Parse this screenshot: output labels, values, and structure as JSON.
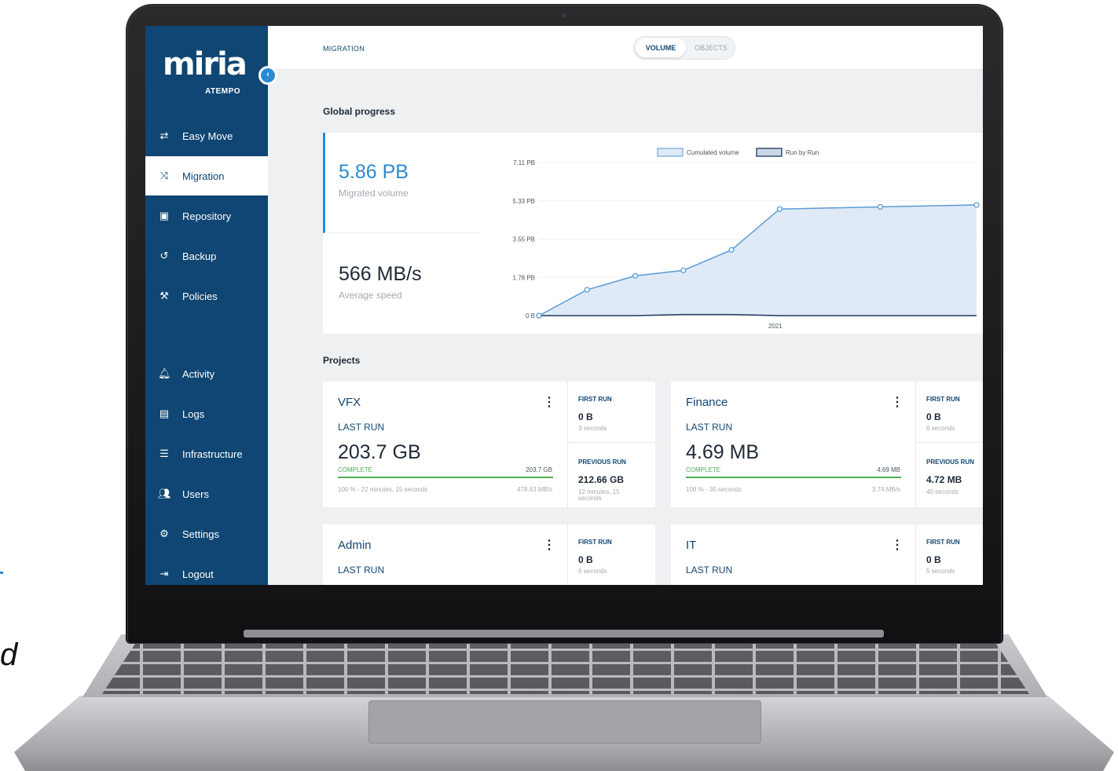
{
  "sidebar": {
    "logo": "miria",
    "logo_sub": "ATEMPO",
    "items": [
      {
        "label": "Easy Move",
        "icon": "swap-arrows-icon"
      },
      {
        "label": "Migration",
        "icon": "migration-arrows-icon"
      },
      {
        "label": "Repository",
        "icon": "repository-icon"
      },
      {
        "label": "Backup",
        "icon": "backup-history-icon"
      },
      {
        "label": "Policies",
        "icon": "gavel-icon"
      },
      {
        "label": "Activity",
        "icon": "bell-icon"
      },
      {
        "label": "Logs",
        "icon": "clipboard-icon"
      },
      {
        "label": "Infrastructure",
        "icon": "server-list-icon"
      },
      {
        "label": "Users",
        "icon": "users-icon"
      },
      {
        "label": "Settings",
        "icon": "gear-icon"
      },
      {
        "label": "Logout",
        "icon": "logout-icon"
      }
    ],
    "active": "Migration"
  },
  "header": {
    "breadcrumb": "MIGRATION",
    "toggle_on": "VOLUME",
    "toggle_off": "OBJECTS"
  },
  "global": {
    "title": "Global progress",
    "volume_value": "5.86 PB",
    "volume_label": "Migrated volume",
    "speed_value": "566 MB/s",
    "speed_label": "Average speed"
  },
  "projects_title": "Projects",
  "projects": [
    {
      "name": "VFX",
      "last_run": "LAST RUN",
      "volume": "203.7 GB",
      "status": "COMPLETE",
      "end_volume": "203.7 GB",
      "progress": 1.0,
      "info": "100 % - 22 minutes, 15 seconds",
      "speed": "478.43 MB/s",
      "first_run_title": "FIRST RUN",
      "first_run_value": "0 B",
      "first_run_time": "3 seconds",
      "prev_run_title": "PREVIOUS RUN",
      "prev_run_value": "212.66 GB",
      "prev_run_time": "12 minutes, 15 seconds"
    },
    {
      "name": "Finance",
      "last_run": "LAST RUN",
      "volume": "4.69 MB",
      "status": "COMPLETE",
      "end_volume": "4.69 MB",
      "progress": 1.0,
      "info": "100 % - 35 seconds",
      "speed": "3.74 MB/s",
      "first_run_title": "FIRST RUN",
      "first_run_value": "0 B",
      "first_run_time": "6 seconds",
      "prev_run_title": "PREVIOUS RUN",
      "prev_run_value": "4.72 MB",
      "prev_run_time": "40 seconds"
    },
    {
      "name": "Admin",
      "last_run": "LAST RUN",
      "first_run_title": "FIRST RUN",
      "first_run_value": "0 B",
      "first_run_time": "6 seconds"
    },
    {
      "name": "IT",
      "last_run": "LAST RUN",
      "first_run_title": "FIRST RUN",
      "first_run_value": "0 B",
      "first_run_time": "5 seconds"
    }
  ],
  "chart_data": {
    "type": "area",
    "series": [
      {
        "name": "Cumulated volume",
        "values": [
          0,
          1.2,
          1.85,
          2.1,
          3.05,
          4.95,
          5.05,
          5.14
        ],
        "color": "#5b9bd5"
      },
      {
        "name": "Run by Run",
        "values": [
          0,
          0,
          0,
          0.05,
          0.05,
          0,
          0,
          0
        ],
        "color": "#1e3a5a"
      }
    ],
    "x_positions": [
      0,
      0.11,
      0.22,
      0.33,
      0.44,
      0.55,
      0.78,
      1.0
    ],
    "x_tick_label": "2021",
    "y_ticks": [
      "0 B",
      "1.78 PB",
      "3.55 PB",
      "5.33 PB",
      "7.11 PB"
    ],
    "ylim": [
      0,
      7.11
    ],
    "legend_position": "top",
    "grid": true
  },
  "page_fragments": {
    "letter": "d"
  }
}
